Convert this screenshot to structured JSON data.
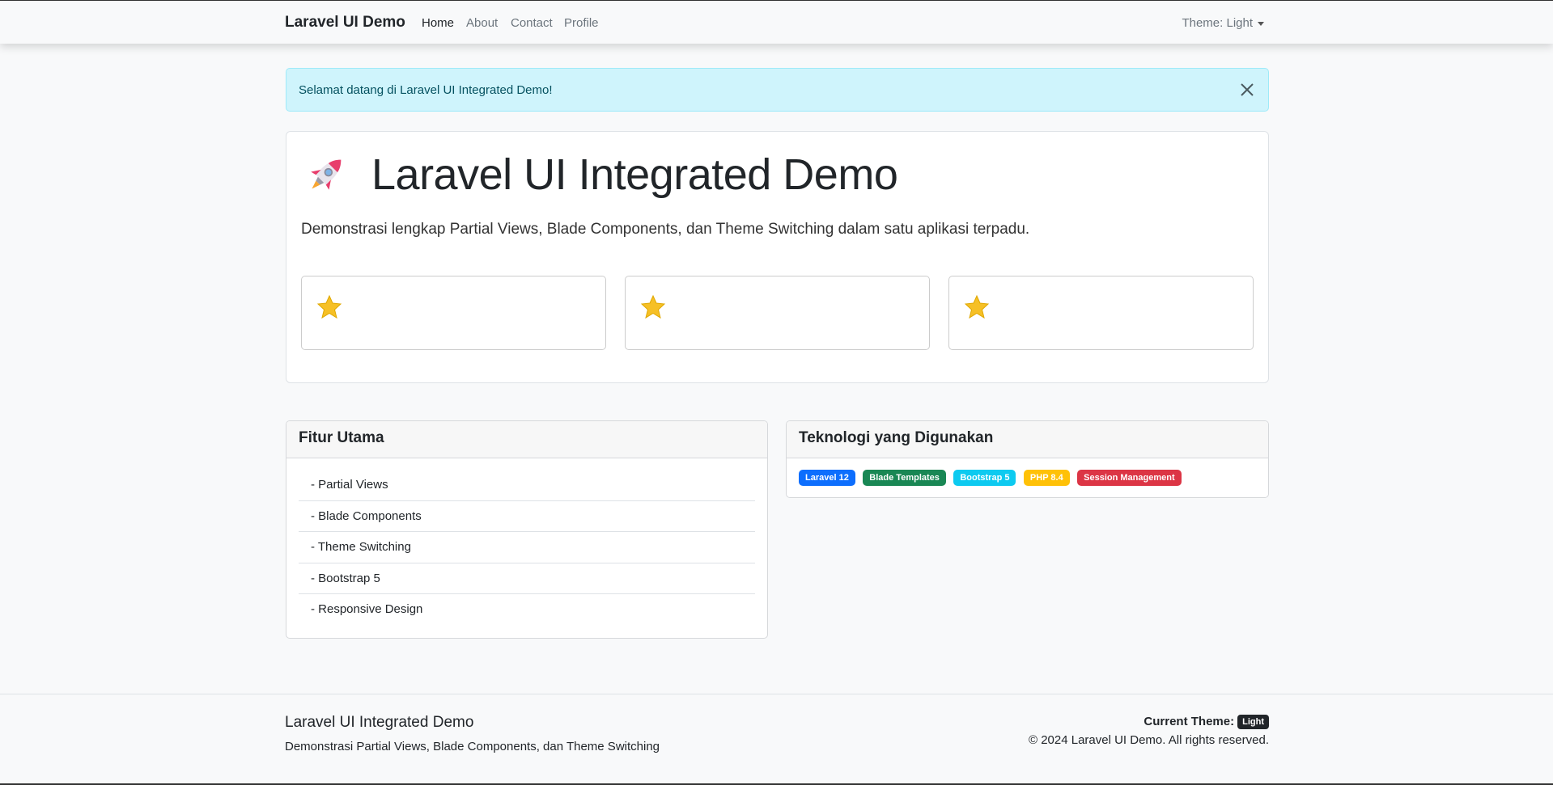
{
  "navbar": {
    "brand": "Laravel UI Demo",
    "links": [
      "Home",
      "About",
      "Contact",
      "Profile"
    ],
    "active_link": "Home",
    "theme_toggle": "Theme: Light"
  },
  "alert": {
    "message": "Selamat datang di Laravel UI Integrated Demo!"
  },
  "hero": {
    "title": "Laravel UI Integrated Demo",
    "lead": "Demonstrasi lengkap Partial Views, Blade Components, dan Theme Switching dalam satu aplikasi terpadu.",
    "icon": "rocket-icon",
    "feature_icon": "star-icon"
  },
  "features_card": {
    "header": "Fitur Utama",
    "items": [
      "- Partial Views",
      "- Blade Components",
      "- Theme Switching",
      "- Bootstrap 5",
      "- Responsive Design"
    ]
  },
  "tech_card": {
    "header": "Teknologi yang Digunakan",
    "badges": [
      {
        "label": "Laravel 12",
        "color": "#0d6efd"
      },
      {
        "label": "Blade Templates",
        "color": "#198754"
      },
      {
        "label": "Bootstrap 5",
        "color": "#0dcaf0"
      },
      {
        "label": "PHP 8.4",
        "color": "#ffc107"
      },
      {
        "label": "Session Management",
        "color": "#dc3545"
      }
    ]
  },
  "footer": {
    "title": "Laravel UI Integrated Demo",
    "description": "Demonstrasi Partial Views, Blade Components, dan Theme Switching",
    "current_theme_label": "Current Theme:",
    "current_theme_value": "Light",
    "copyright": "© 2024 Laravel UI Demo. All rights reserved."
  }
}
